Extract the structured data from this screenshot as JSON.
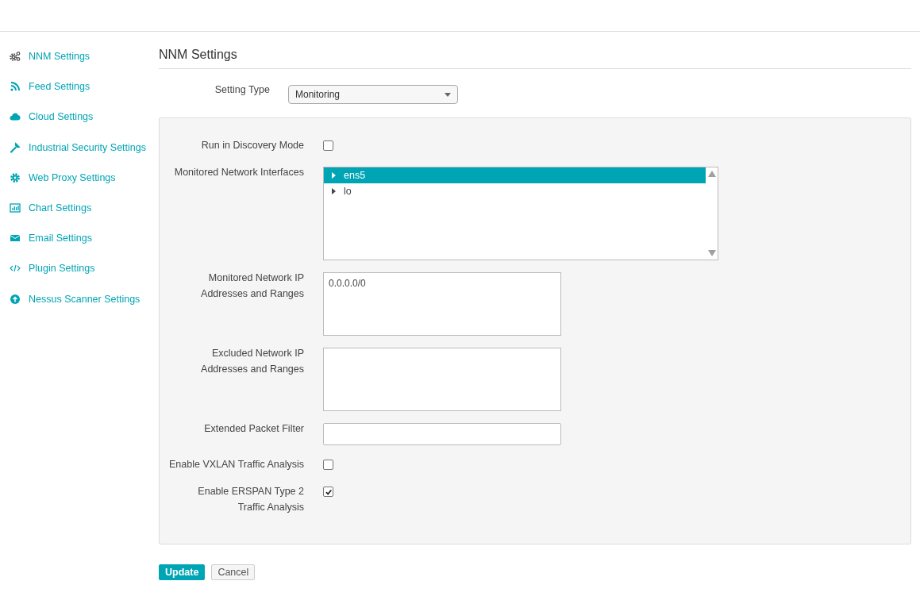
{
  "sidebar": {
    "items": [
      {
        "label": "NNM Settings",
        "selected": false
      },
      {
        "label": "Feed Settings",
        "selected": false
      },
      {
        "label": "Cloud Settings",
        "selected": false
      },
      {
        "label": "Industrial Security Settings",
        "selected": false
      },
      {
        "label": "Web Proxy Settings",
        "selected": false
      },
      {
        "label": "Chart Settings",
        "selected": false
      },
      {
        "label": "Email Settings",
        "selected": false
      },
      {
        "label": "Plugin Settings",
        "selected": false
      },
      {
        "label": "Nessus Scanner Settings",
        "selected": false
      }
    ]
  },
  "page_title": "NNM Settings",
  "setting_type": {
    "label": "Setting Type",
    "value": "Monitoring"
  },
  "fields": [
    {
      "kind": "checkbox",
      "label": "Run in Discovery Mode",
      "checked": false
    },
    {
      "kind": "listbox",
      "label": "Monitored Network Interfaces",
      "options": [
        {
          "label": "ens5",
          "selected": true
        },
        {
          "label": "lo",
          "selected": false
        }
      ]
    },
    {
      "kind": "textarea",
      "label": "Monitored Network IP Addresses and Ranges",
      "value": "0.0.0.0/0"
    },
    {
      "kind": "textarea",
      "label": "Excluded Network IP Addresses and Ranges"
    },
    {
      "kind": "input",
      "label": "Extended Packet Filter"
    },
    {
      "kind": "checkbox",
      "label": "Enable VXLAN Traffic Analysis",
      "checked": false
    },
    {
      "kind": "checkbox",
      "label": "Enable ERSPAN Type 2 Traffic Analysis",
      "checked": true
    }
  ],
  "buttons": {
    "primary": "Update",
    "secondary": "Cancel"
  }
}
